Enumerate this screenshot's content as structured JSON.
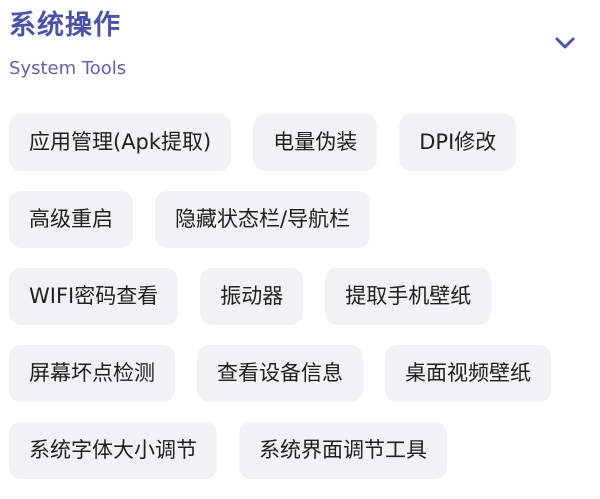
{
  "header": {
    "title": "系统操作",
    "subtitle": "System Tools",
    "collapse_icon": "chevron-down-icon",
    "accent_color": "#4a52b0"
  },
  "tools": {
    "rows": [
      [
        "应用管理(Apk提取)",
        "电量伪装",
        "DPI修改"
      ],
      [
        "高级重启",
        "隐藏状态栏/导航栏"
      ],
      [
        "WIFI密码查看",
        "振动器",
        "提取手机壁纸"
      ],
      [
        "屏幕坏点检测",
        "查看设备信息",
        "桌面视频壁纸"
      ],
      [
        "系统字体大小调节",
        "系统界面调节工具"
      ]
    ]
  },
  "style": {
    "chip_background": "#f2f2f4",
    "text_color": "#202020"
  }
}
